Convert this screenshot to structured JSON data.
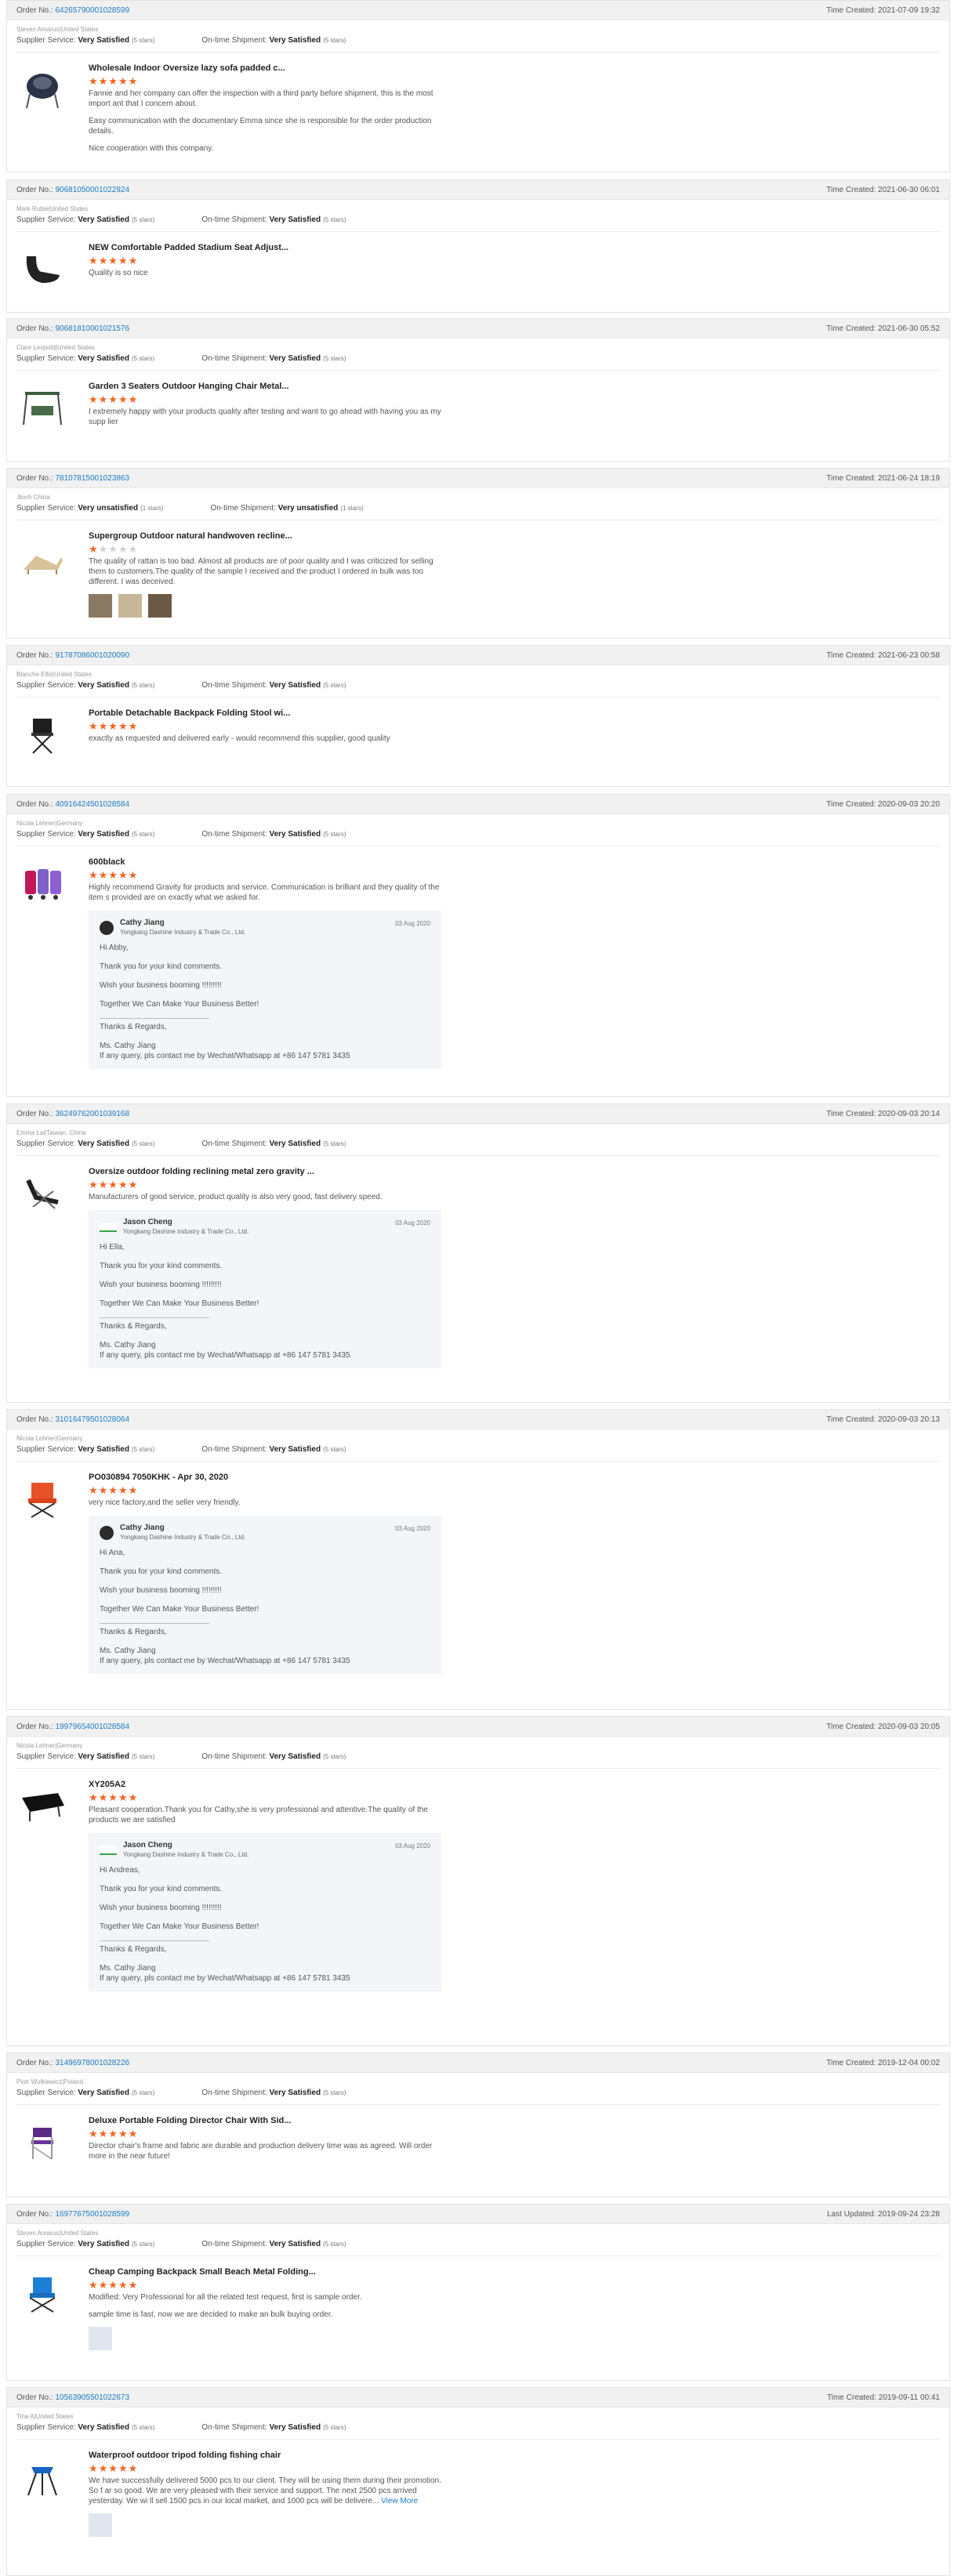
{
  "labels": {
    "order_no": "Order No.:",
    "time_created": "Time Created:",
    "last_updated": "Last Updated:",
    "supplier_service": "Supplier Service:",
    "ontime_shipment": "On-time Shipment:",
    "view_more": "View More"
  },
  "reviews": [
    {
      "order_no": "64265790001028599",
      "time_label": "Time Created:",
      "time": "2021-07-09 19:32",
      "buyer": "Steven Amarus|United States",
      "service": "Very Satisfied",
      "service_stars": "(5 stars)",
      "shipment": "Very Satisfied",
      "shipment_stars": "(5 stars)",
      "title": "Wholesale Indoor Oversize lazy sofa padded c...",
      "rating": 5,
      "text": [
        "Fannie and her company can offer the inspection with a third party before shipment, this is the most import ant that I concern about.",
        "Easy communication with the documentary Emma since she is responsible for the order production details.",
        "Nice cooperation with this company."
      ],
      "icon": "chair-icon"
    },
    {
      "order_no": "90681050001022924",
      "time_label": "Time Created:",
      "time": "2021-06-30 06:01",
      "buyer": "Mark Rubie|United States",
      "service": "Very Satisfied",
      "service_stars": "(5 stars)",
      "shipment": "Very Satisfied",
      "shipment_stars": "(5 stars)",
      "title": "NEW Comfortable Padded Stadium Seat Adjust...",
      "rating": 5,
      "text": [
        "Quality is so nice"
      ],
      "icon": "seat-icon"
    },
    {
      "order_no": "90681810001021576",
      "time_label": "Time Created:",
      "time": "2021-06-30 05:52",
      "buyer": "Clare Leopold|United States",
      "service": "Very Satisfied",
      "service_stars": "(5 stars)",
      "shipment": "Very Satisfied",
      "shipment_stars": "(5 stars)",
      "title": "Garden 3 Seaters Outdoor Hanging Chair Metal...",
      "rating": 5,
      "text": [
        "I extremely happy with your products quality after testing and want to go ahead with having you as my supp lier"
      ],
      "icon": "swing-icon"
    },
    {
      "order_no": "78107815001023863",
      "time_label": "Time Created:",
      "time": "2021-06-24 18:19",
      "buyer": "Jbxrh China",
      "service": "Very unsatisfied",
      "service_stars": "(1 stars)",
      "shipment": "Very unsatisfied",
      "shipment_stars": "(1 stars)",
      "title": "Supergroup Outdoor natural handwoven recline...",
      "rating": 1,
      "text": [
        "The quality of rattan is too bad. Almost all products are of poor quality and I was criticized for selling them to customers.The quality of the sample I received and the product I ordered in bulk was too different. I was deceived."
      ],
      "icon": "lounger-icon",
      "photos": 3
    },
    {
      "order_no": "91787086001020090",
      "time_label": "Time Created:",
      "time": "2021-06-23 00:58",
      "buyer": "Blanche Ellis|United States",
      "service": "Very Satisfied",
      "service_stars": "(5 stars)",
      "shipment": "Very Satisfied",
      "shipment_stars": "(5 stars)",
      "title": "Portable Detachable Backpack Folding Stool wi...",
      "rating": 5,
      "text": [
        "exactly as requested and delivered early - would recommend this supplier, good quality"
      ],
      "icon": "stool-icon"
    },
    {
      "order_no": "40916424501028584",
      "time_label": "Time Created:",
      "time": "2020-09-03 20:20",
      "buyer": "Nicola Lehner|Germany",
      "service": "Very Satisfied",
      "service_stars": "(5 stars)",
      "shipment": "Very Satisfied",
      "shipment_stars": "(5 stars)",
      "title": "600black",
      "rating": 5,
      "text": [
        "Highly recommend Gravity for products and service. Communication is brilliant and they quality of the item s provided are on exactly what we asked for."
      ],
      "icon": "trolley-icon",
      "reply": {
        "name": "Cathy Jiang",
        "company": "Yongkang Dashine Industry & Trade Co., Ltd.",
        "date": "03 Aug 2020",
        "lines": [
          "Hi Abby,",
          "Thank you for your kind comments.",
          "Wish your business booming !!!!!!!!!",
          "Together We Can Make Your Business Better!",
          "Thanks & Regards,"
        ],
        "sign": "Ms.  Cathy Jiang",
        "contact": "If any query, pls contact me by Wechat/Whatsapp at +86 147 5781 3435",
        "logo": false
      }
    },
    {
      "order_no": "36249762001039168",
      "time_label": "Time Created:",
      "time": "2020-09-03 20:14",
      "buyer": "Emma Lai|Taiwan, China",
      "service": "Very Satisfied",
      "service_stars": "(5 stars)",
      "shipment": "Very Satisfied",
      "shipment_stars": "(5 stars)",
      "title": "Oversize outdoor folding reclining metal zero gravity ...",
      "rating": 5,
      "text": [
        "Manufacturers of good service, product quality is also very good, fast delivery speed."
      ],
      "icon": "recliner-icon",
      "reply": {
        "name": "Jason Cheng",
        "company": "Yongkang Dashine Industry & Trade Co., Ltd.",
        "date": "03 Aug 2020",
        "lines": [
          "Hi Ella,",
          "Thank you for your kind comments.",
          "Wish your business booming !!!!!!!!!",
          "Together We Can Make Your Business Better!",
          "Thanks & Regards,"
        ],
        "sign": "Ms.  Cathy Jiang",
        "contact": "If any query, pls contact me by Wechat/Whatsapp at +86 147 5781 3435",
        "logo": true
      }
    },
    {
      "order_no": "31016479501028064",
      "time_label": "Time Created:",
      "time": "2020-09-03 20:13",
      "buyer": "Nicola Lehner|Germany",
      "service": "Very Satisfied",
      "service_stars": "(5 stars)",
      "shipment": "Very Satisfied",
      "shipment_stars": "(5 stars)",
      "title": "PO030894 7050KHK - Apr 30, 2020",
      "rating": 5,
      "text": [
        "very nice factory,and the seller very friendly."
      ],
      "icon": "camp-chair-icon",
      "reply": {
        "name": "Cathy Jiang",
        "company": "Yongkang Dashine Industry & Trade Co., Ltd.",
        "date": "03 Aug 2020",
        "lines": [
          "Hi Ana,",
          "Thank you for your kind comments.",
          "Wish your business booming !!!!!!!!!",
          "Together We Can Make Your Business Better!",
          "Thanks & Regards,"
        ],
        "sign": "Ms.  Cathy Jiang",
        "contact": "If any query, pls contact me by Wechat/Whatsapp at +86 147 5781 3435",
        "logo": false
      }
    },
    {
      "order_no": "19979654001028584",
      "time_label": "Time Created:",
      "time": "2020-09-03 20:05",
      "buyer": "Nicola Lehner|Germany",
      "service": "Very Satisfied",
      "service_stars": "(5 stars)",
      "shipment": "Very Satisfied",
      "shipment_stars": "(5 stars)",
      "title": "XY205A2",
      "rating": 5,
      "text": [
        "Pleasant cooperation.Thank you for Cathy,she is very professional and attentive.The quality of the products we are satisfied"
      ],
      "icon": "cot-icon",
      "reply": {
        "name": "Jason Cheng",
        "company": "Yongkang Dashine Industry & Trade Co., Ltd.",
        "date": "03 Aug 2020",
        "lines": [
          "Hi Andreas,",
          "Thank you for your kind comments.",
          "Wish your business booming !!!!!!!!!",
          "Together We Can Make Your Business Better!",
          "Thanks & Regards,"
        ],
        "sign": "Ms.  Cathy Jiang",
        "contact": "If any query, pls contact me by Wechat/Whatsapp at +86 147 5781 3435",
        "logo": true
      }
    },
    {
      "order_no": "31496978001028226",
      "time_label": "Time Created:",
      "time": "2019-12-04 00:02",
      "buyer": "Piotr Wulkiewicz|Poland",
      "service": "Very Satisfied",
      "service_stars": "(5 stars)",
      "shipment": "Very Satisfied",
      "shipment_stars": "(5 stars)",
      "title": "Deluxe Portable Folding Director Chair With Sid...",
      "rating": 5,
      "text": [
        "Director chair's frame and fabric are durable and production delivery time was as agreed. Will order more in the near future!"
      ],
      "icon": "director-chair-icon"
    },
    {
      "order_no": "16977675001028599",
      "time_label": "Last Updated:",
      "time": "2019-09-24 23:28",
      "buyer": "Steven Amarus|United States",
      "service": "Very Satisfied",
      "service_stars": "(5 stars)",
      "shipment": "Very Satisfied",
      "shipment_stars": "(5 stars)",
      "title": "Cheap Camping Backpack Small Beach Metal Folding...",
      "rating": 5,
      "text": [
        "Modified: Very Professional for all the related test request, first is sample order.",
        "sample time is fast, now we are decided to make an bulk buying order."
      ],
      "icon": "beach-chair-icon",
      "photos": 1
    },
    {
      "order_no": "10563905501022673",
      "time_label": "Time Created:",
      "time": "2019-09-11 00:41",
      "buyer": "Tina A|United States",
      "service": "Very Satisfied",
      "service_stars": "(5 stars)",
      "shipment": "Very Satisfied",
      "shipment_stars": "(5 stars)",
      "title": "Waterproof outdoor tripod folding fishing chair",
      "rating": 5,
      "text": [
        "We have successfully delivered 5000 pcs to our client. They will be using them during their promotion. So f ar so good. We are very pleased with their service and support. The next 2500 pcs arrived yesterday. We wi ll sell 1500 pcs in our local market, and 1000 pcs will be delivere..."
      ],
      "icon": "tripod-stool-icon",
      "photos": 1,
      "view_more": true
    }
  ]
}
